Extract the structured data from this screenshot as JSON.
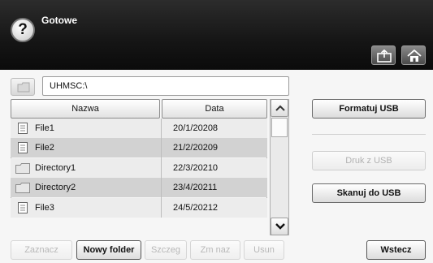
{
  "header": {
    "help_symbol": "?",
    "title": "Gotowe",
    "icons": [
      "usb-import-icon",
      "home-icon"
    ]
  },
  "path": {
    "icon": "folder-up-icon",
    "value": "UHMSC:\\"
  },
  "table": {
    "columns": [
      "Nazwa",
      "Data"
    ],
    "rows": [
      {
        "type": "file",
        "icon": "file-icon",
        "name": "File1",
        "date": "20/1/20208",
        "shaded": false
      },
      {
        "type": "file",
        "icon": "file-icon",
        "name": "File2",
        "date": "21/2/20209",
        "shaded": true
      },
      {
        "type": "folder",
        "icon": "folder-icon",
        "name": "Directory1",
        "date": "22/3/20210",
        "shaded": false
      },
      {
        "type": "folder",
        "icon": "folder-icon",
        "name": "Directory2",
        "date": "23/4/20211",
        "shaded": true
      },
      {
        "type": "file",
        "icon": "file-icon",
        "name": "File3",
        "date": "24/5/20212",
        "shaded": false
      }
    ]
  },
  "scrollbar": {
    "up_icon": "chevron-up-icon",
    "down_icon": "chevron-down-icon"
  },
  "right_panel": {
    "format_usb": "Formatuj USB",
    "print_from_usb": "Druk z USB",
    "scan_to_usb": "Skanuj do USB"
  },
  "bottom_bar": {
    "select": "Zaznacz",
    "new_folder": "Nowy folder",
    "details": "Szczeg",
    "rename": "Zm naz",
    "delete": "Usun",
    "back": "Wstecz"
  }
}
